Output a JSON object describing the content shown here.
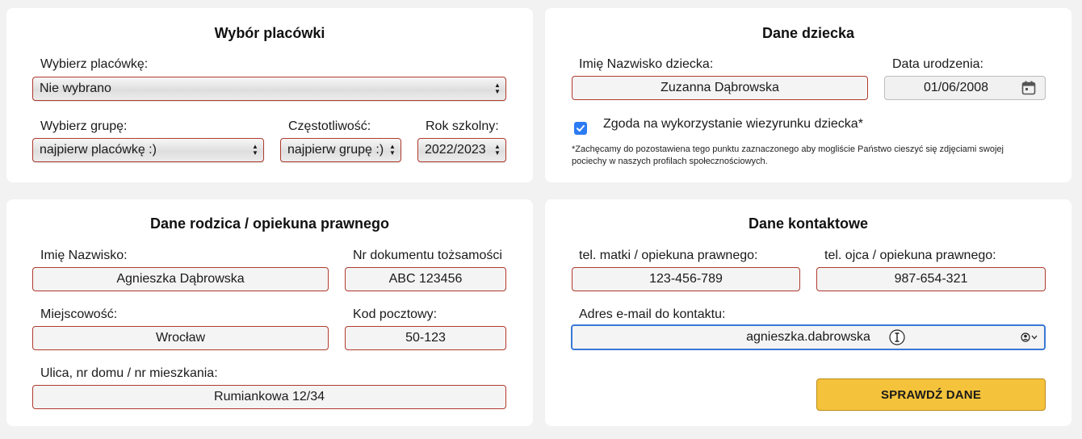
{
  "facility": {
    "title": "Wybór placówki",
    "facility_label": "Wybierz placówkę:",
    "facility_value": "Nie wybrano",
    "group_label": "Wybierz grupę:",
    "group_value": "najpierw placówkę :)",
    "frequency_label": "Częstotliwość:",
    "frequency_value": "najpierw grupę :)",
    "year_label": "Rok szkolny:",
    "year_value": "2022/2023"
  },
  "child": {
    "title": "Dane dziecka",
    "name_label": "Imię Nazwisko dziecka:",
    "name_value": "Zuzanna Dąbrowska",
    "birth_label": "Data urodzenia:",
    "birth_value": "01/06/2008",
    "consent_label": "Zgoda na wykorzystanie wiezyrunku dziecka*",
    "consent_checked": true,
    "consent_note": "*Zachęcamy do pozostawiena tego punktu zaznaczonego aby mogliście Państwo cieszyć się zdjęciami swojej pociechy w naszych profilach społecznościowych."
  },
  "parent": {
    "title": "Dane rodzica / opiekuna prawnego",
    "name_label": "Imię Nazwisko:",
    "name_value": "Agnieszka Dąbrowska",
    "doc_label": "Nr dokumentu tożsamości",
    "doc_value": "ABC 123456",
    "city_label": "Miejscowość:",
    "city_value": "Wrocław",
    "postal_label": "Kod pocztowy:",
    "postal_value": "50-123",
    "street_label": "Ulica, nr domu / nr mieszkania:",
    "street_value": "Rumiankowa 12/34"
  },
  "contact": {
    "title": "Dane kontaktowe",
    "mother_phone_label": "tel. matki / opiekuna prawnego:",
    "mother_phone_value": "123-456-789",
    "father_phone_label": "tel. ojca / opiekuna prawnego:",
    "father_phone_value": "987-654-321",
    "email_label": "Adres e-mail do kontaktu:",
    "email_value": "agnieszka.dabrowska",
    "submit_label": "SPRAWDŹ DANE"
  },
  "colors": {
    "background": "#f2f2f2",
    "card": "#ffffff",
    "field_border": "#b13a2e",
    "focus_border": "#3a78d6",
    "button": "#f5c33b",
    "checkbox": "#2d7bf4"
  },
  "icons": [
    "select-arrows-icon",
    "calendar-icon",
    "checkmark-icon",
    "text-cursor-icon",
    "autofill-contact-icon",
    "chevron-down-icon"
  ]
}
